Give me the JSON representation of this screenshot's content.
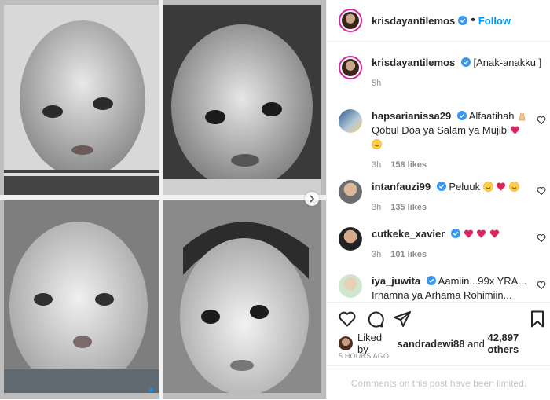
{
  "post": {
    "author": "krisdayantilemos",
    "follow_label": "Follow",
    "separator": "•",
    "caption": "[Anak-anakku ]",
    "caption_time": "5h"
  },
  "comments": [
    {
      "user": "hapsarianissa29",
      "text_a": "Alfaatihah",
      "text_b": "Qobul Doa ya Salam ya Mujib",
      "time": "3h",
      "likes": "158 likes"
    },
    {
      "user": "intanfauzi99",
      "text_a": "Peluuk",
      "text_b": "",
      "time": "3h",
      "likes": "135 likes"
    },
    {
      "user": "cutkeke_xavier",
      "text_a": "",
      "text_b": "",
      "time": "3h",
      "likes": "101 likes"
    },
    {
      "user": "iya_juwita",
      "text_a": "Aamiin...99x YRA...",
      "text_b": "Irhamna ya Arhama Rohimiin...",
      "time": "",
      "likes": ""
    }
  ],
  "likes_line": {
    "prefix": "Liked by",
    "user": "sandradewi88",
    "connector": "and",
    "count": "42,897 others"
  },
  "timestamp": "5 HOURS AGO",
  "comments_notice": "Comments on this post have been limited.",
  "icons": {
    "verified": "verified-badge-icon",
    "heart": "heart-icon",
    "comment": "comment-icon",
    "share": "share-icon",
    "save": "bookmark-icon",
    "next": "chevron-right-icon"
  },
  "colors": {
    "accent": "#0095f6",
    "heart_emoji": "#e0245e",
    "verified": "#3897f0",
    "meta": "#8e8e8e"
  }
}
